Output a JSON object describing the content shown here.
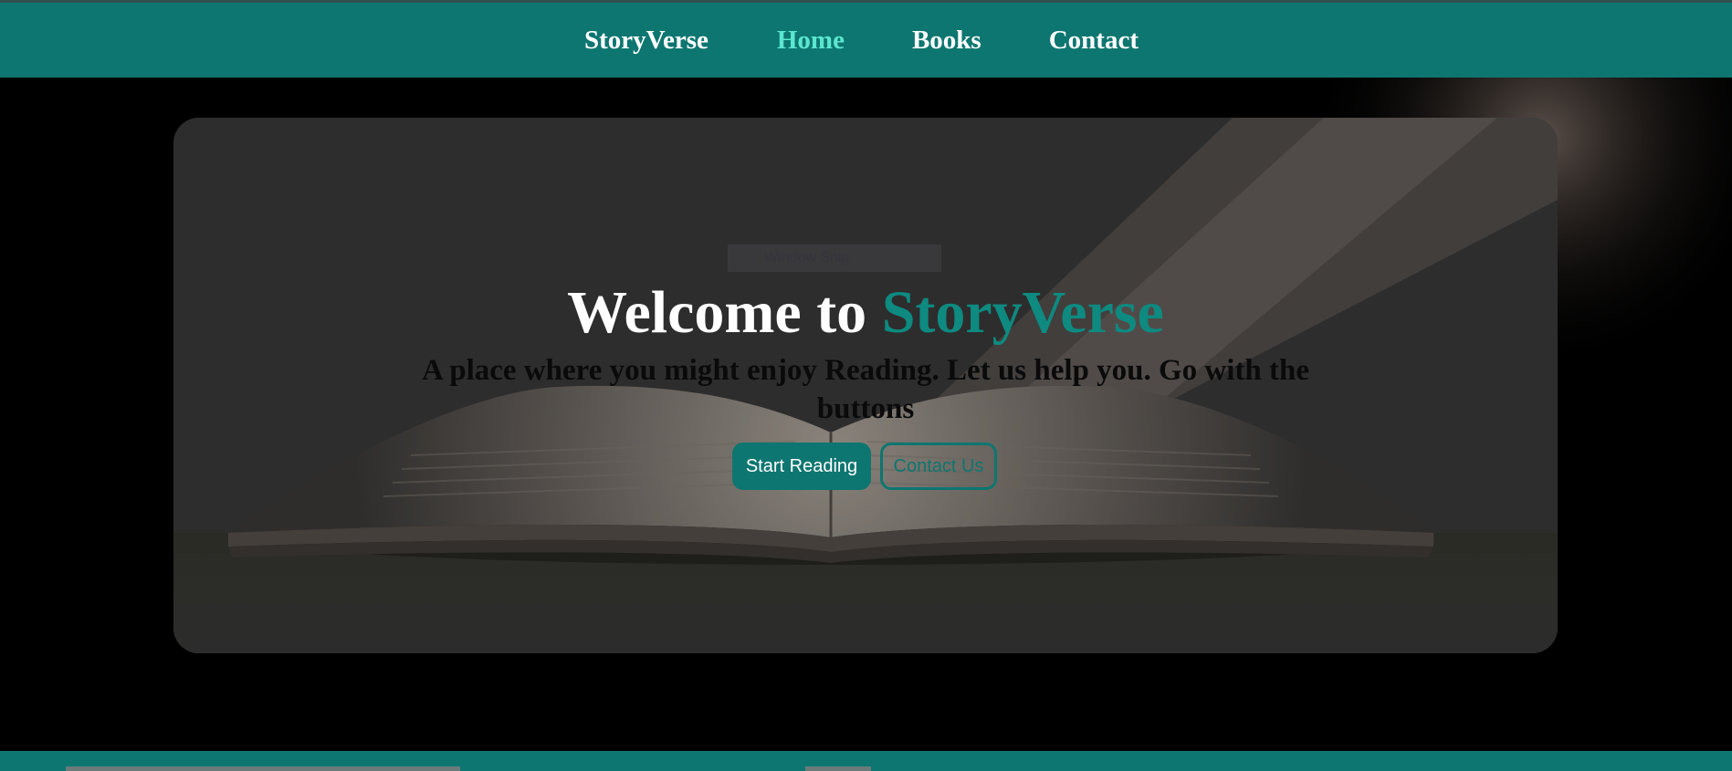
{
  "nav": {
    "brand": "StoryVerse",
    "items": [
      {
        "label": "Home",
        "active": true
      },
      {
        "label": "Books",
        "active": false
      },
      {
        "label": "Contact",
        "active": false
      }
    ]
  },
  "hero": {
    "overlay_label": "Window Snip",
    "title_prefix": "Welcome to ",
    "title_accent": "StoryVerse",
    "subtitle": "A place where you might enjoy Reading. Let us help you. Go with the buttons",
    "primary_button": "Start Reading",
    "secondary_button": "Contact Us"
  },
  "colors": {
    "brand_teal": "#0e7670",
    "active_nav": "#5ce6cf",
    "title_accent": "#0e8a80"
  }
}
